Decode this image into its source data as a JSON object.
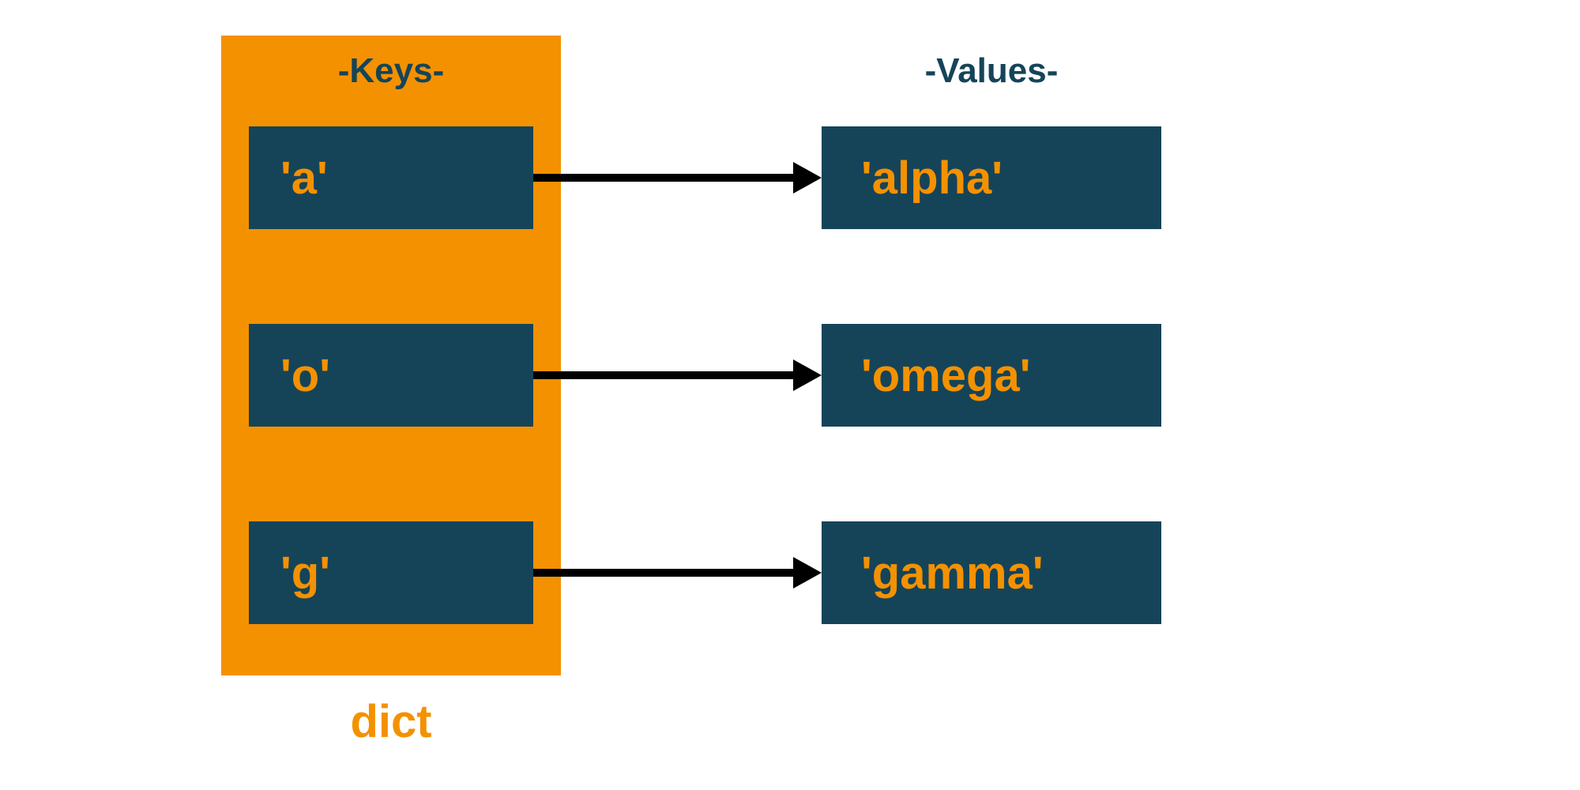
{
  "headings": {
    "keys": "-Keys-",
    "values": "-Values-"
  },
  "entries": [
    {
      "key": "'a'",
      "value": "'alpha'"
    },
    {
      "key": "'o'",
      "value": "'omega'"
    },
    {
      "key": "'g'",
      "value": "'gamma'"
    }
  ],
  "label": "dict",
  "colors": {
    "accent": "#f49100",
    "box": "#154459",
    "arrow": "#000000",
    "background": "#ffffff"
  }
}
